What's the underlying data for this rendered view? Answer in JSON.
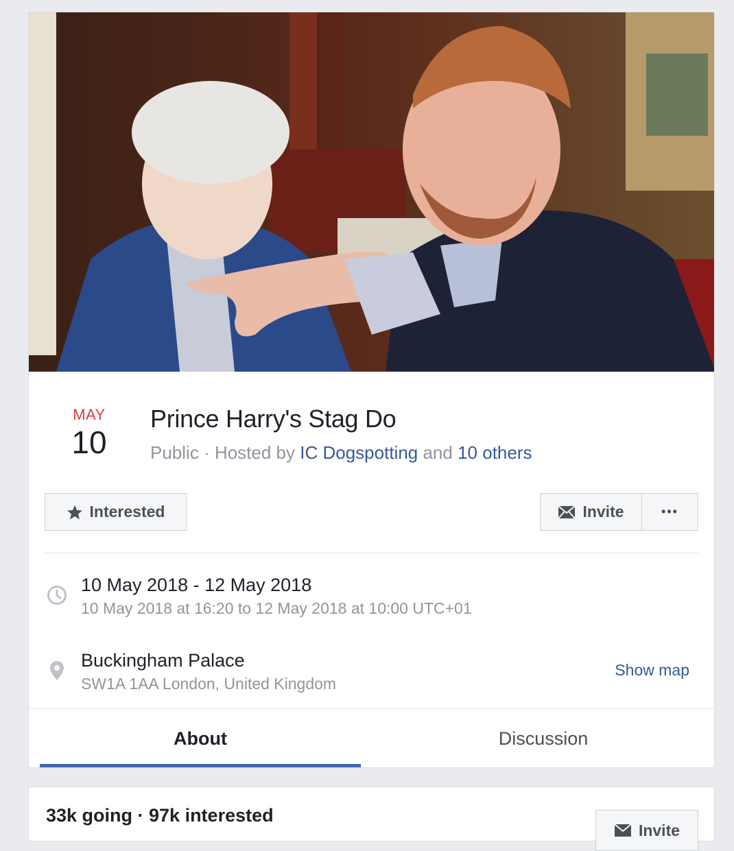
{
  "event": {
    "date_month": "MAY",
    "date_day": "10",
    "title": "Prince Harry's Stag Do",
    "privacy": "Public",
    "hosted_by_prefix": "· Hosted by",
    "host_link": "IC Dogspotting",
    "and_text": "and",
    "others_link": "10 others"
  },
  "actions": {
    "interested_label": "Interested",
    "invite_label": "Invite",
    "more_label": "•••"
  },
  "details": {
    "when_main": "10 May 2018 - 12 May 2018",
    "when_sub": "10 May 2018 at 16:20 to 12 May 2018 at 10:00 UTC+01",
    "where_main": "Buckingham Palace",
    "where_sub": "SW1A 1AA London, United Kingdom",
    "show_map": "Show map"
  },
  "tabs": [
    {
      "label": "About",
      "active": true
    },
    {
      "label": "Discussion",
      "active": false
    }
  ],
  "stats": {
    "summary": "33k going · 97k interested",
    "invite_label": "Invite"
  },
  "colors": {
    "accent": "#4267b2",
    "link": "#365899",
    "month_red": "#e0393e"
  },
  "icons": {
    "interested": "star-icon",
    "invite": "envelope-icon",
    "time": "clock-icon",
    "place": "location-pin-icon"
  }
}
